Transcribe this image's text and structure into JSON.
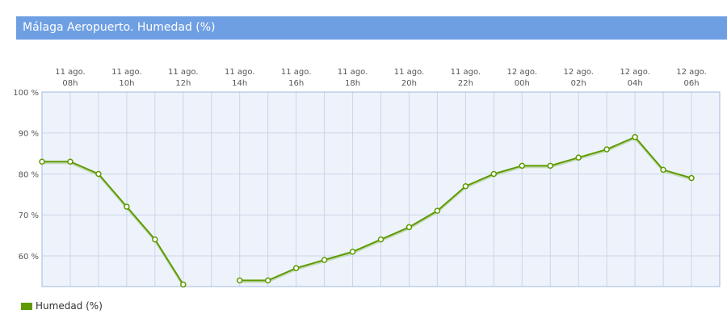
{
  "chart_data": {
    "type": "line",
    "title": "Málaga Aeropuerto. Humedad (%)",
    "x_ticks": [
      {
        "l1": "11 ago.",
        "l2": "08h"
      },
      {
        "l1": "11 ago.",
        "l2": "10h"
      },
      {
        "l1": "11 ago.",
        "l2": "12h"
      },
      {
        "l1": "11 ago.",
        "l2": "14h"
      },
      {
        "l1": "11 ago.",
        "l2": "16h"
      },
      {
        "l1": "11 ago.",
        "l2": "18h"
      },
      {
        "l1": "11 ago.",
        "l2": "20h"
      },
      {
        "l1": "11 ago.",
        "l2": "22h"
      },
      {
        "l1": "12 ago.",
        "l2": "00h"
      },
      {
        "l1": "12 ago.",
        "l2": "02h"
      },
      {
        "l1": "12 ago.",
        "l2": "04h"
      },
      {
        "l1": "12 ago.",
        "l2": "06h"
      }
    ],
    "y_ticks": [
      "100 %",
      "90 %",
      "80 %",
      "70 %",
      "60 %"
    ],
    "y_tick_values": [
      100,
      90,
      80,
      70,
      60
    ],
    "ylim": [
      52.5,
      100
    ],
    "x": [
      "11 ago. 07h",
      "11 ago. 08h",
      "11 ago. 09h",
      "11 ago. 10h",
      "11 ago. 11h",
      "11 ago. 12h",
      "11 ago. 13h",
      "11 ago. 14h",
      "11 ago. 15h",
      "11 ago. 16h",
      "11 ago. 17h",
      "11 ago. 18h",
      "11 ago. 19h",
      "11 ago. 20h",
      "11 ago. 21h",
      "11 ago. 22h",
      "11 ago. 23h",
      "12 ago. 00h",
      "12 ago. 01h",
      "12 ago. 02h",
      "12 ago. 03h",
      "12 ago. 04h",
      "12 ago. 05h",
      "12 ago. 06h",
      "12 ago. 07h"
    ],
    "series": [
      {
        "name": "Humedad (%)",
        "color": "#5e9a00",
        "values": [
          83,
          83,
          80,
          72,
          64,
          53,
          null,
          54,
          54,
          57,
          59,
          61,
          64,
          67,
          71,
          77,
          80,
          82,
          82,
          84,
          86,
          89,
          81,
          79
        ]
      }
    ],
    "grid": true,
    "legend_position": "bottom-left"
  }
}
